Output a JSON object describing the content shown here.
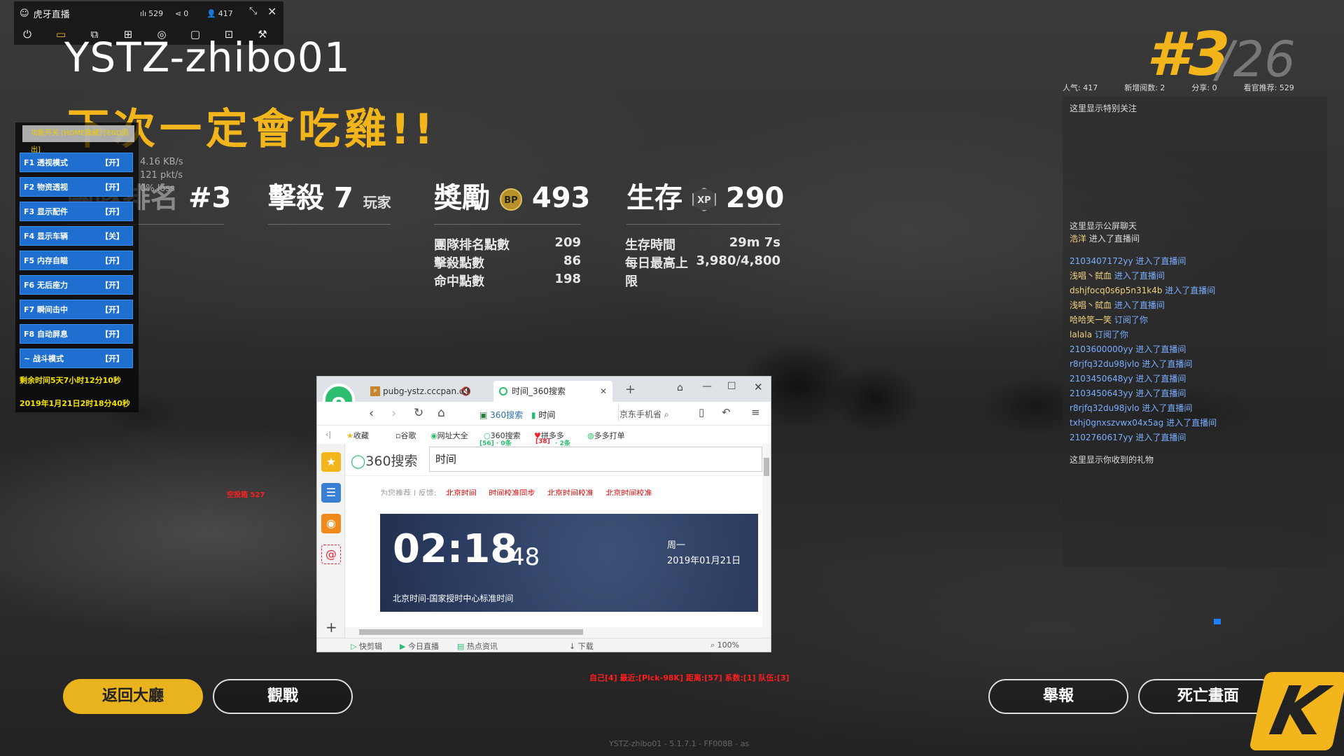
{
  "app": {
    "title": "虎牙直播",
    "heat": "529",
    "shares": "0",
    "viewers": "417"
  },
  "stream": {
    "name": "YSTZ-zhibo01",
    "slogan": "下次一定會吃雞!!"
  },
  "match": {
    "rank_label": "團隊排名",
    "rank_value": "#3",
    "kill_label": "擊殺",
    "kill_value": "7",
    "kill_unit": "玩家",
    "reward_label": "獎勵",
    "reward_icon": "BP",
    "reward_value": "493",
    "survival_label": "生存",
    "survival_icon": "XP",
    "survival_value": "290",
    "details": [
      {
        "label": "團隊排名點數",
        "value": "209"
      },
      {
        "label": "擊殺點數",
        "value": "86"
      },
      {
        "label": "命中點數",
        "value": "198"
      }
    ],
    "survival_details": [
      {
        "label": "生存時間",
        "value": "29m 7s"
      },
      {
        "label": "每日最高上限",
        "value": "3,980/4,800"
      }
    ]
  },
  "cheat_menu": {
    "header": "功能开关 [HOME隐藏] [END退出]",
    "items": [
      {
        "key": "F1 透视模式",
        "state": "【开】"
      },
      {
        "key": "F2 物资透视",
        "state": "【开】"
      },
      {
        "key": "F3 显示配件",
        "state": "【开】"
      },
      {
        "key": "F4 显示车辆",
        "state": "【关】"
      },
      {
        "key": "F5 内存自瞄",
        "state": "【开】"
      },
      {
        "key": "F6 无后座力",
        "state": "【开】"
      },
      {
        "key": "F7 瞬间击中",
        "state": "【开】"
      },
      {
        "key": "F8 自动屏息",
        "state": "【开】"
      },
      {
        "key": "~ 战斗模式",
        "state": "【开】"
      }
    ],
    "remaining": "剩余时间5天7小时12分10秒",
    "datetime": "2019年1月21日2时18分40秒"
  },
  "net": {
    "line1": "4.16 KB/s",
    "line2": "121 pkt/s",
    "line3": "0% loss"
  },
  "final_rank": {
    "rank": "#3",
    "total": "/26"
  },
  "room_stats": {
    "popularity": "人气: 417",
    "new_subs": "新增阅数: 2",
    "share": "分享: 0",
    "recommend": "看官推荐: 529"
  },
  "chat": {
    "special_title": "这里显示特别关注",
    "public_title": "这里显示公屏聊天",
    "gift_title": "这里显示你收到的礼物",
    "messages": [
      {
        "user": "浩洋",
        "text": "进入了直播间"
      },
      {
        "user": "2103407172yy",
        "text": "进入了直播间"
      },
      {
        "user": "浅唱丶弑血",
        "text": "进入了直播间"
      },
      {
        "user": "dshjfocq0s6p5n31k4b",
        "text": "进入了直播间"
      },
      {
        "user": "浅唱丶弑血",
        "text": "进入了直播间"
      },
      {
        "user": "哈哈笑一笑",
        "text": "订阅了你"
      },
      {
        "user": "lalala",
        "text": "订阅了你"
      },
      {
        "user": "2103600000yy",
        "text": "进入了直播间"
      },
      {
        "user": "r8rjfq32du98jvlo",
        "text": "进入了直播间"
      },
      {
        "user": "2103450648yy",
        "text": "进入了直播间"
      },
      {
        "user": "2103450643yy",
        "text": "进入了直播间"
      },
      {
        "user": "r8rjfq32du98jvlo",
        "text": "进入了直播间"
      },
      {
        "user": "txhj0gnxszvwx04x5ag",
        "text": "进入了直播间"
      },
      {
        "user": "2102760617yy",
        "text": "进入了直播间"
      }
    ]
  },
  "browser": {
    "tab1": "pubg-ystz.cccpan.c",
    "tab2": "时间_360搜索",
    "address_1": "360搜索",
    "address_2": "时间",
    "right_search": "京东手机省",
    "favorites": [
      "收藏",
      "谷歌",
      "网址大全",
      "360搜索",
      "拼多多",
      "多多打单"
    ],
    "fav_green": "[56] · 0条",
    "fav_red": "[38]",
    "fav_green2": "· 2条",
    "search_logo": "360搜索",
    "search_value": "时间",
    "related_prefix": "为您推荐 | 反馈:",
    "related_links": [
      "北京时间",
      "时间校准同步",
      "北京时间校准",
      "北京时间校准"
    ],
    "time_hm": "02:18",
    "time_s": "48",
    "weekday": "周一",
    "date": "2019年01月21日",
    "caption": "北京时间-国家授时中心标准时间",
    "status": [
      "快剪辑",
      "今日直播",
      "热点资讯",
      "下载",
      "100%"
    ]
  },
  "hud_red": "空投箱 527",
  "bottom_red": "自己[4]  最近:[Pick-98K]  距离:[57]  系数:[1]  队伍:[3]",
  "buttons": {
    "lobby": "返回大廳",
    "spectate": "觀戰",
    "report": "舉報",
    "death_cam": "死亡畫面"
  },
  "watermark": "YSTZ-zhibo01 - 5.1.7.1 - FF008B - as",
  "brand_k": "K",
  "colors": {
    "accent": "#f2b51c",
    "menu_blue": "#1f6fd0",
    "chat_blue": "#7aaeff",
    "alert_red": "#ff1e1e"
  }
}
